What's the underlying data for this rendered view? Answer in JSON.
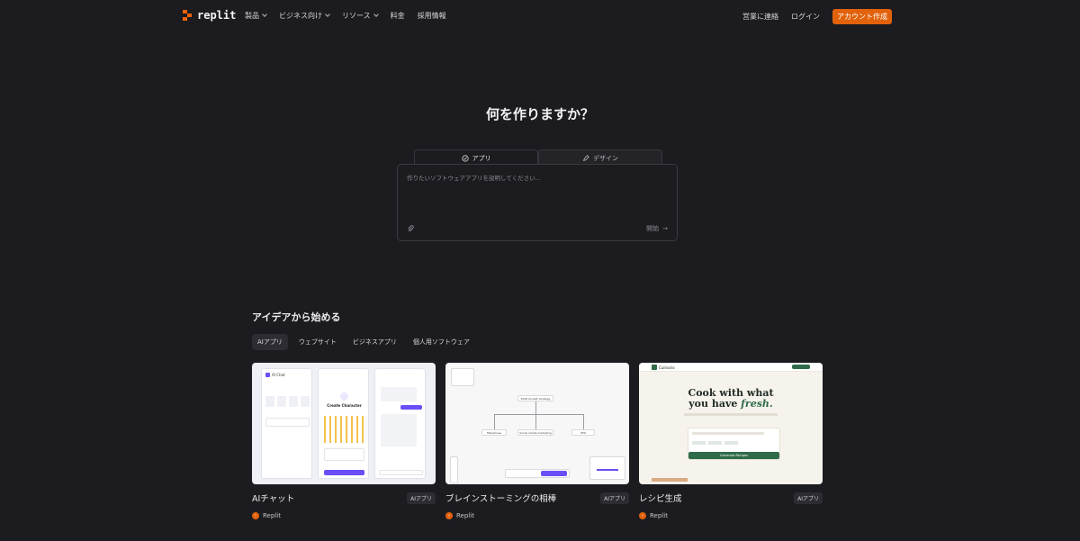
{
  "nav": {
    "brand": "replit",
    "links": [
      {
        "label": "製品",
        "dropdown": true
      },
      {
        "label": "ビジネス向け",
        "dropdown": true
      },
      {
        "label": "リソース",
        "dropdown": true
      },
      {
        "label": "料金",
        "dropdown": false
      },
      {
        "label": "採用情報",
        "dropdown": false
      }
    ],
    "contact": "営業に連絡",
    "login": "ログイン",
    "signup": "アカウント作成"
  },
  "hero": {
    "title": "何を作りますか？",
    "tabs": [
      {
        "label": "アプリ",
        "icon": "app-icon",
        "active": true
      },
      {
        "label": "デザイン",
        "icon": "pencil-icon",
        "active": false
      }
    ],
    "placeholder": "作りたいソフトウェアアプリを説明してください...",
    "start_label": "開始"
  },
  "ideas": {
    "title": "アイデアから始める",
    "chips": [
      "AIアプリ",
      "ウェブサイト",
      "ビジネスアプリ",
      "個人用ソフトウェア"
    ],
    "cards": [
      {
        "title": "AIチャット",
        "badge": "AIアプリ",
        "author": "Replit"
      },
      {
        "title": "ブレインストーミングの相棒",
        "badge": "AIアプリ",
        "author": "Replit"
      },
      {
        "title": "レシピ生成",
        "badge": "AIアプリ",
        "author": "Replit"
      }
    ]
  },
  "thumbs": {
    "chat": {
      "label": "AI Chat",
      "heading": "Create Character",
      "button": "Create Character"
    },
    "brain": {
      "root": "2026 Growth strategy",
      "nodes": [
        "Milestones",
        "Social media marketing",
        "SEO"
      ]
    },
    "recipe": {
      "brand": "Culinario",
      "line1": "Cook with what",
      "line2": "you have ",
      "line2_em": "fresh.",
      "button": "Generate Recipes"
    }
  },
  "colors": {
    "accent": "#e2620c",
    "background": "#1c1c20",
    "purple": "#6b4ef6",
    "green": "#2f6b4a"
  }
}
